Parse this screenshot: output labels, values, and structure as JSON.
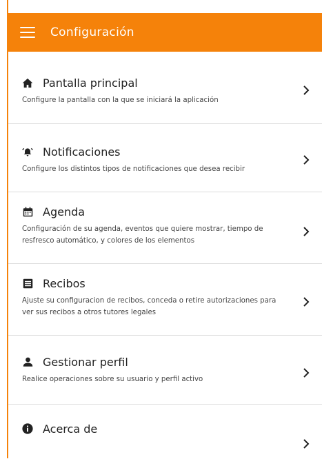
{
  "colors": {
    "accent": "#F5820A",
    "background": "#ffffff",
    "divider": "#dcdcdc"
  },
  "header": {
    "title": "Configuración",
    "menu_icon": "menu-icon"
  },
  "items": [
    {
      "icon": "home-icon",
      "title": "Pantalla principal",
      "description": "Configure la pantalla con la que se iniciará la aplicación"
    },
    {
      "icon": "alarm-bell-icon",
      "title": "Notificaciones",
      "description": "Configure los distintos tipos de notificaciones que desea recibir"
    },
    {
      "icon": "calendar-icon",
      "title": "Agenda",
      "description": "Configuración de su agenda, eventos que quiere mostrar, tiempo de resfresco automático, y colores de los elementos"
    },
    {
      "icon": "receipt-icon",
      "title": "Recibos",
      "description": "Ajuste su configuracion de recibos, conceda o retire autorizaciones para ver sus recibos a otros tutores legales"
    },
    {
      "icon": "person-icon",
      "title": "Gestionar perfil",
      "description": "Realice operaciones sobre su usuario y perfil activo"
    },
    {
      "icon": "info-icon",
      "title": "Acerca de",
      "description": ""
    }
  ]
}
